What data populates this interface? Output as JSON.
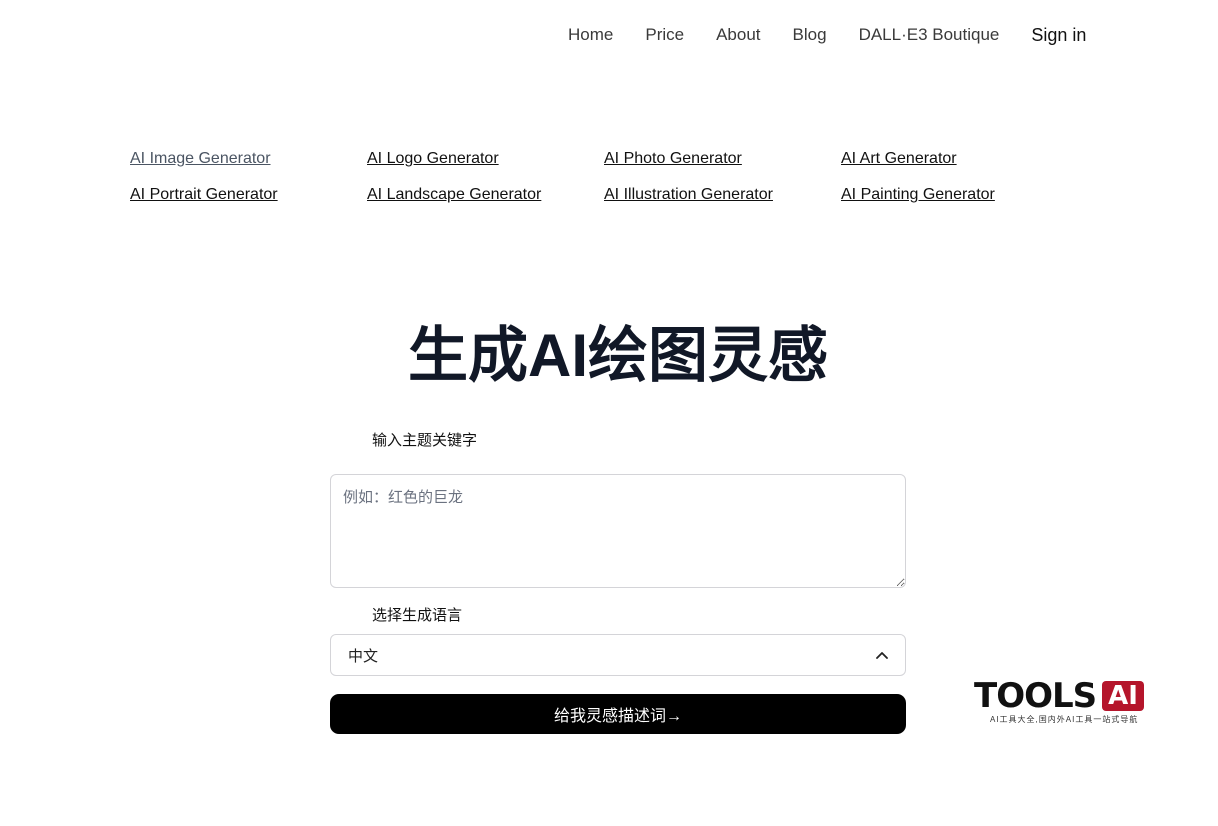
{
  "nav": {
    "items": [
      "Home",
      "Price",
      "About",
      "Blog",
      "DALL·E3 Boutique"
    ],
    "signin": "Sign in"
  },
  "generators": [
    "AI Image Generator",
    "AI Logo Generator",
    "AI Photo Generator",
    "AI Art Generator",
    "AI Portrait Generator",
    "AI Landscape Generator",
    "AI Illustration Generator",
    "AI Painting Generator"
  ],
  "hero": {
    "title": "生成AI绘图灵感"
  },
  "form": {
    "keyword_label": "输入主题关键字",
    "keyword_placeholder": "例如：红色的巨龙",
    "keyword_value": "",
    "language_label": "选择生成语言",
    "language_selected": "中文",
    "submit_label": "给我灵感描述词→"
  },
  "watermark": {
    "brand": "TOOLS",
    "badge": "AI",
    "tagline": "AI工具大全,国内外AI工具一站式导航"
  },
  "colors": {
    "button_bg": "#000000",
    "title": "#111827",
    "watermark_badge": "#b5152b"
  }
}
